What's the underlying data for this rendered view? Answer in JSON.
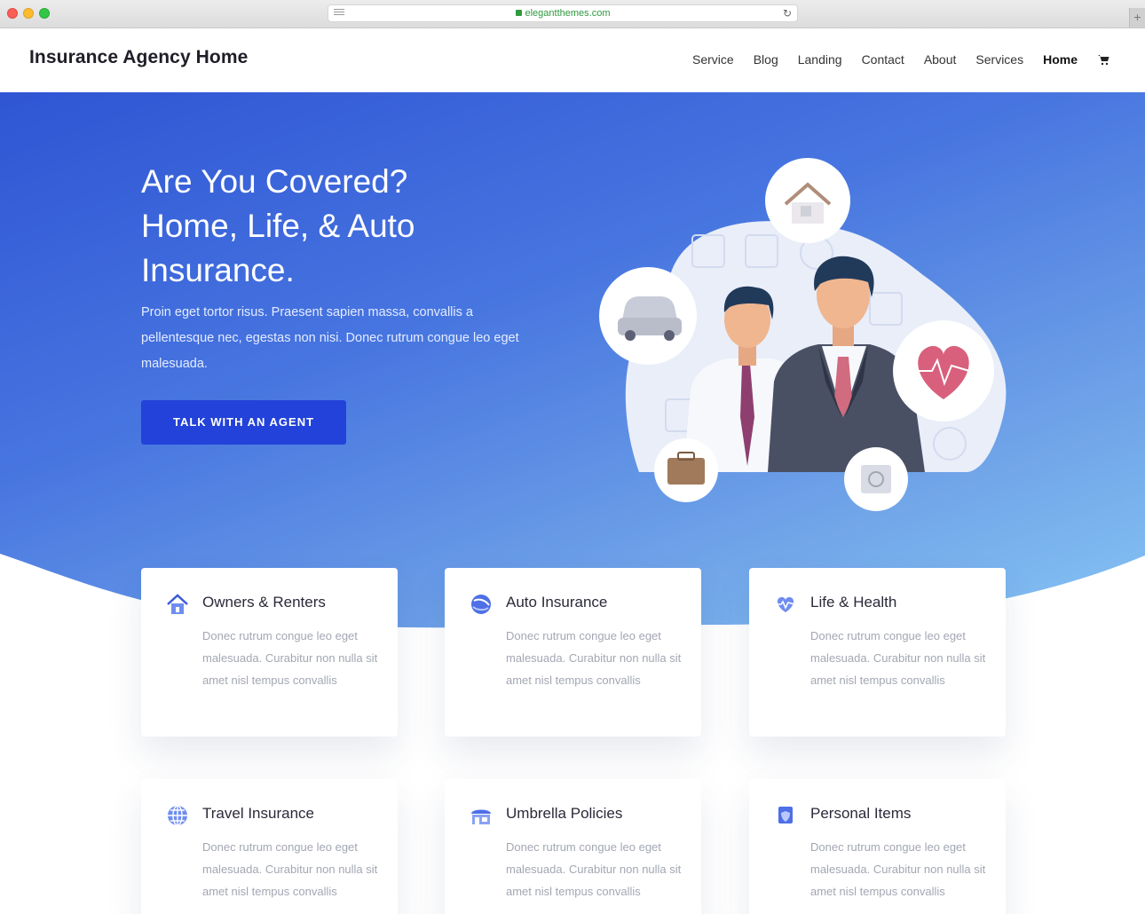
{
  "browser": {
    "url": "elegantthemes.com"
  },
  "header": {
    "logo": "Insurance Agency Home",
    "nav": [
      {
        "label": "Service"
      },
      {
        "label": "Blog"
      },
      {
        "label": "Landing"
      },
      {
        "label": "Contact"
      },
      {
        "label": "About"
      },
      {
        "label": "Services"
      },
      {
        "label": "Home"
      }
    ],
    "cart_icon": "cart-icon"
  },
  "hero": {
    "title_lines": [
      "Are You Covered?",
      "Home, Life, & Auto",
      "Insurance."
    ],
    "text": "Proin eget tortor risus. Praesent sapien massa, convallis a pellentesque nec, egestas non nisi. Donec rutrum congue leo eget malesuada.",
    "cta": "TALK WITH AN AGENT"
  },
  "colors": {
    "accent": "#2242d9",
    "hero_start": "#2f55d4",
    "hero_end": "#86c5f4"
  },
  "cards": [
    {
      "title": "Owners & Renters",
      "icon": "house-icon",
      "text": "Donec rutrum congue leo eget malesuada. Curabitur non nulla sit amet nisl tempus convallis"
    },
    {
      "title": "Auto Insurance",
      "icon": "globe-swirl-icon",
      "text": "Donec rutrum congue leo eget malesuada. Curabitur non nulla sit amet nisl tempus convallis"
    },
    {
      "title": "Life & Health",
      "icon": "heart-pulse-icon",
      "text": "Donec rutrum congue leo eget malesuada. Curabitur non nulla sit amet nisl tempus convallis"
    },
    {
      "title": "Travel Insurance",
      "icon": "globe-icon",
      "text": "Donec rutrum congue leo eget malesuada. Curabitur non nulla sit amet nisl tempus convallis"
    },
    {
      "title": "Umbrella Policies",
      "icon": "storefront-icon",
      "text": "Donec rutrum congue leo eget malesuada. Curabitur non nulla sit amet nisl tempus convallis"
    },
    {
      "title": "Personal Items",
      "icon": "shield-item-icon",
      "text": "Donec rutrum congue leo eget malesuada. Curabitur non nulla sit amet nisl tempus convallis"
    }
  ]
}
